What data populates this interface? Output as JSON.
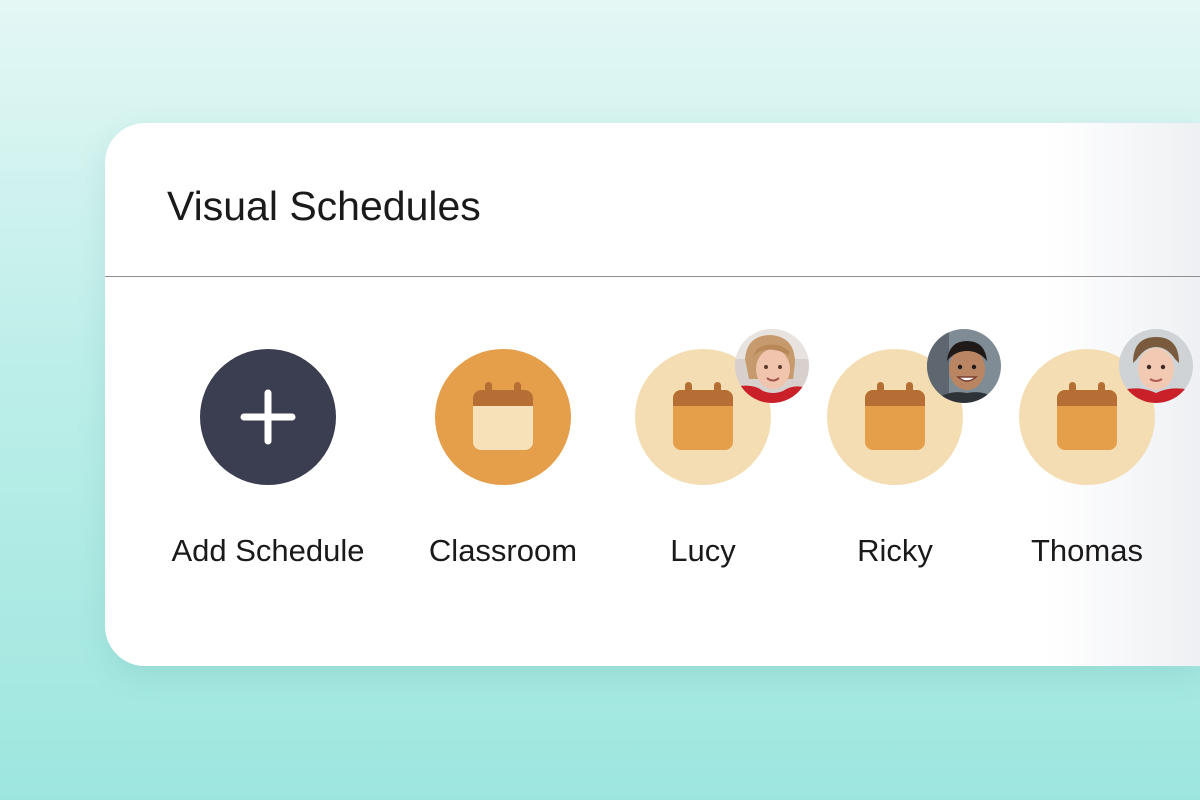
{
  "card": {
    "title": "Visual Schedules"
  },
  "schedules": [
    {
      "label": "Add Schedule",
      "icon": "plus-icon"
    },
    {
      "label": "Classroom",
      "icon": "calendar-icon"
    },
    {
      "label": "Lucy",
      "icon": "calendar-icon",
      "avatar": "student-photo-icon"
    },
    {
      "label": "Ricky",
      "icon": "calendar-icon",
      "avatar": "student-photo-icon"
    },
    {
      "label": "Thomas",
      "icon": "calendar-icon",
      "avatar": "student-photo-icon"
    }
  ],
  "colors": {
    "add_button": "#3a3e50",
    "classroom_circle": "#e59e4a",
    "student_circle": "#f4ddb2",
    "calendar_dark": "#b56f34",
    "calendar_body": "#e59e4a",
    "calendar_light": "#f6e1b8"
  }
}
